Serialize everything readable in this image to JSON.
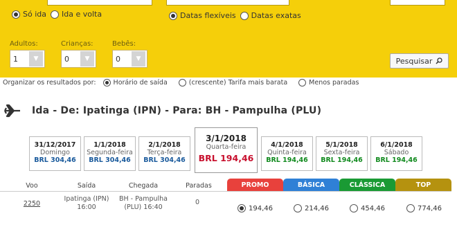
{
  "trip": {
    "one_way": "Só ida",
    "round_trip": "Ida e volta",
    "flexible_dates": "Datas flexíveis",
    "exact_dates": "Datas exatas"
  },
  "passengers": {
    "adults": {
      "label": "Adultos:",
      "value": "1"
    },
    "children": {
      "label": "Crianças:",
      "value": "0"
    },
    "infants": {
      "label": "Bebês:",
      "value": "0"
    }
  },
  "search_button": "Pesquisar",
  "sort": {
    "label": "Organizar os resultados por:",
    "options": [
      "Horário de saída",
      "(crescente) Tarifa mais barata",
      "Menos paradas"
    ]
  },
  "route_title": "Ida - De: Ipatinga (IPN) - Para: BH - Pampulha (PLU)",
  "dates": [
    {
      "date": "31/12/2017",
      "weekday": "Domingo",
      "price": "BRL 304,46",
      "color": "#1a5a9c"
    },
    {
      "date": "1/1/2018",
      "weekday": "Segunda-feira",
      "price": "BRL 304,46",
      "color": "#1a5a9c"
    },
    {
      "date": "2/1/2018",
      "weekday": "Terça-feira",
      "price": "BRL 304,46",
      "color": "#1a5a9c"
    },
    {
      "date": "3/1/2018",
      "weekday": "Quarta-feira",
      "price": "BRL 194,46",
      "color": "#c8102e"
    },
    {
      "date": "4/1/2018",
      "weekday": "Quinta-feira",
      "price": "BRL 194,46",
      "color": "#118a1e"
    },
    {
      "date": "5/1/2018",
      "weekday": "Sexta-feira",
      "price": "BRL 194,46",
      "color": "#118a1e"
    },
    {
      "date": "6/1/2018",
      "weekday": "Sábado",
      "price": "BRL 194,46",
      "color": "#118a1e"
    }
  ],
  "table": {
    "headers": [
      "Voo",
      "Saída",
      "Chegada",
      "Paradas"
    ],
    "fare_tabs": [
      {
        "label": "PROMO",
        "color": "#e8413c"
      },
      {
        "label": "BÁSICA",
        "color": "#2f80d6"
      },
      {
        "label": "CLÁSSICA",
        "color": "#1a9a34"
      },
      {
        "label": "TOP",
        "color": "#b5920f"
      }
    ],
    "rows": [
      {
        "flight": "2250",
        "departure_place": "Ipatinga (IPN)",
        "departure_time": "16:00",
        "arrival_place": "BH - Pampulha",
        "arrival_time": "(PLU) 16:40",
        "stops": "0",
        "fares": [
          "194,46",
          "214,46",
          "454,46",
          "774,46"
        ]
      }
    ]
  }
}
